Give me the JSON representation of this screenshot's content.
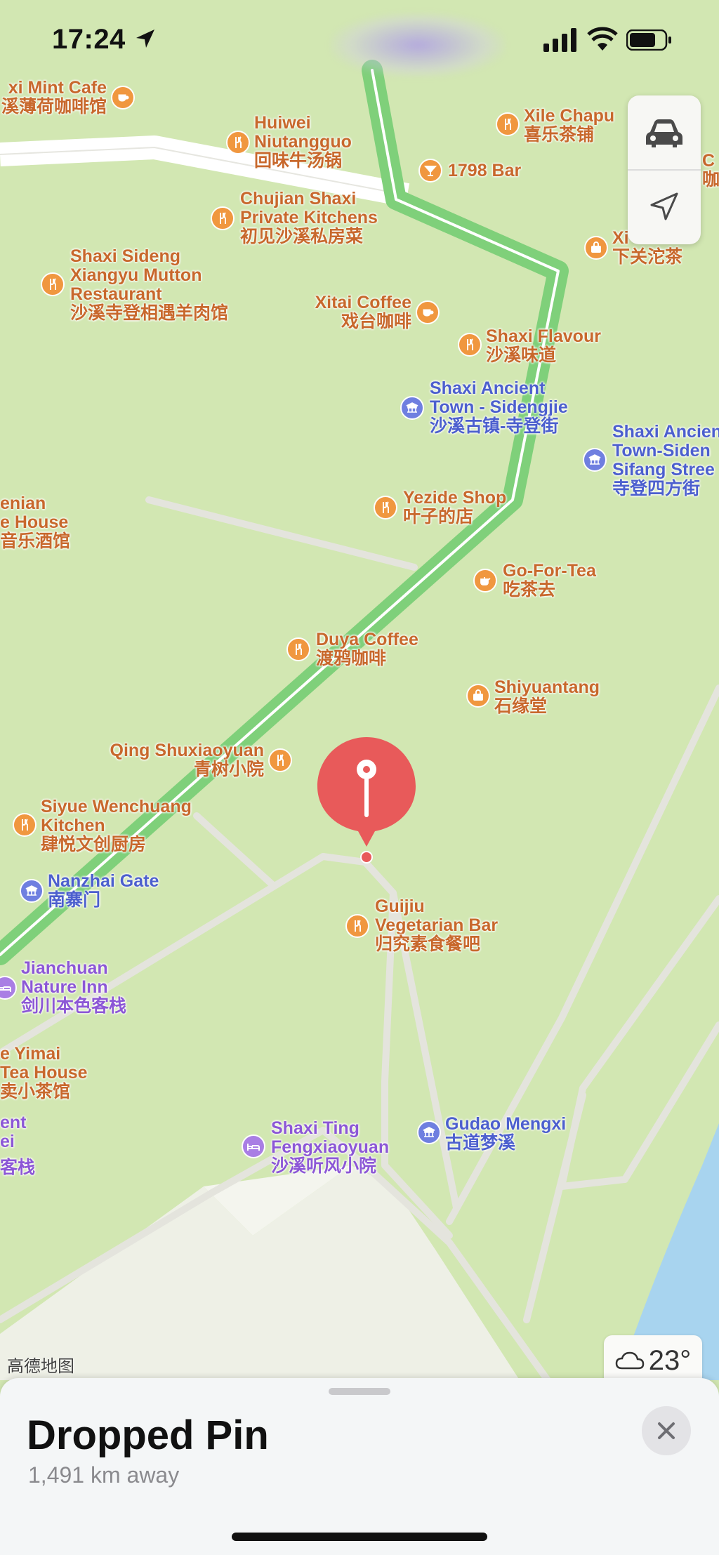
{
  "status_bar": {
    "time": "17:24"
  },
  "map": {
    "attribution": "高德地图",
    "pois": [
      {
        "key": "mint_cafe",
        "type": "food",
        "lines": [
          "xi Mint Cafe",
          "溪薄荷咖啡馆"
        ]
      },
      {
        "key": "huiwei",
        "type": "food",
        "lines": [
          "Huiwei",
          "Niutangguo",
          "回味牛汤锅"
        ]
      },
      {
        "key": "xile",
        "type": "food",
        "lines": [
          "Xile Chapu",
          "喜乐茶铺"
        ]
      },
      {
        "key": "bar1798",
        "type": "food",
        "lines": [
          "1798 Bar"
        ]
      },
      {
        "key": "chujian",
        "type": "food",
        "lines": [
          "Chujian Shaxi",
          "Private Kitchens",
          "初见沙溪私房菜"
        ]
      },
      {
        "key": "xiaguan",
        "type": "shop",
        "lines": [
          "Xi",
          "下关沱茶"
        ]
      },
      {
        "key": "sideng_mutton",
        "type": "food",
        "lines": [
          "Shaxi Sideng",
          "Xiangyu Mutton",
          "Restaurant",
          "沙溪寺登相遇羊肉馆"
        ]
      },
      {
        "key": "xitai",
        "type": "food",
        "lines": [
          "Xitai Coffee",
          "戏台咖啡"
        ]
      },
      {
        "key": "shaxi_flavour",
        "type": "food",
        "lines": [
          "Shaxi Flavour",
          "沙溪味道"
        ]
      },
      {
        "key": "sidengjie",
        "type": "culture",
        "lines": [
          "Shaxi Ancient",
          "Town - Sidengjie",
          "沙溪古镇-寺登街"
        ]
      },
      {
        "key": "sifang",
        "type": "culture",
        "lines": [
          "Shaxi Ancien",
          "Town-Siden",
          "Sifang Stree",
          "寺登四方街"
        ]
      },
      {
        "key": "armenian",
        "type": "food",
        "lines": [
          "enian",
          "e House",
          "音乐酒馆"
        ]
      },
      {
        "key": "yezide",
        "type": "food",
        "lines": [
          "Yezide Shop",
          "叶子的店"
        ]
      },
      {
        "key": "gofortea",
        "type": "food",
        "lines": [
          "Go-For-Tea",
          "吃茶去"
        ]
      },
      {
        "key": "duya",
        "type": "food",
        "lines": [
          "Duya Coffee",
          "渡鸦咖啡"
        ]
      },
      {
        "key": "shiyuantang",
        "type": "shop",
        "lines": [
          "Shiyuantang",
          "石缘堂"
        ]
      },
      {
        "key": "qing",
        "type": "food",
        "lines": [
          "Qing Shuxiaoyuan",
          "青树小院"
        ]
      },
      {
        "key": "siyue",
        "type": "food",
        "lines": [
          "Siyue Wenchuang",
          "Kitchen",
          "肆悦文创厨房"
        ]
      },
      {
        "key": "nanzhai",
        "type": "culture",
        "lines": [
          "Nanzhai Gate",
          "南寨门"
        ]
      },
      {
        "key": "guijiu",
        "type": "food",
        "lines": [
          "Guijiu",
          "Vegetarian Bar",
          "归究素食餐吧"
        ]
      },
      {
        "key": "jianchuan",
        "type": "hotel",
        "lines": [
          "Jianchuan",
          "Nature Inn",
          "剑川本色客栈"
        ]
      },
      {
        "key": "yimai",
        "type": "food",
        "lines": [
          "e Yimai",
          "Tea House",
          "卖小茶馆"
        ]
      },
      {
        "key": "ent",
        "type": "hotel",
        "lines": [
          "ent",
          "ei",
          "客栈"
        ]
      },
      {
        "key": "shaxiting",
        "type": "hotel",
        "lines": [
          "Shaxi Ting",
          "Fengxiaoyuan",
          "沙溪听风小院"
        ]
      },
      {
        "key": "gudao",
        "type": "culture",
        "lines": [
          "Gudao Mengxi",
          "古道梦溪"
        ]
      },
      {
        "key": "c_edge",
        "type": "food",
        "lines": [
          "C",
          "咖"
        ]
      }
    ]
  },
  "controls": {
    "icons": [
      "car-icon",
      "location-arrow-icon"
    ]
  },
  "weather": {
    "temperature": "23°",
    "icon": "cloud-icon"
  },
  "sheet": {
    "title": "Dropped Pin",
    "subtitle": "1,491 km away"
  },
  "colors": {
    "route": "#7fd07a",
    "pin": "#e85a5a",
    "food": "#f0973f",
    "culture": "#6f7fe0",
    "hotel": "#a97ee4",
    "water": "#a8d4ef"
  }
}
